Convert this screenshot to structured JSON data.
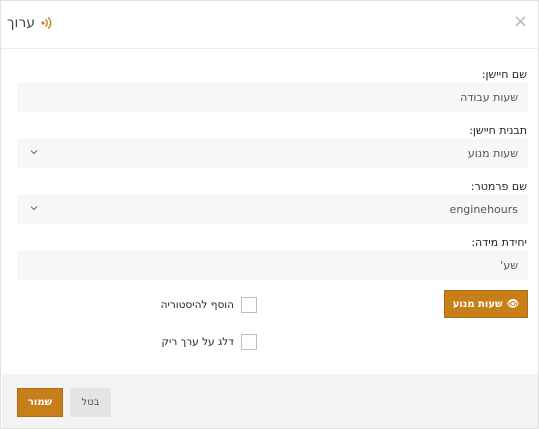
{
  "header": {
    "title": "ערוך",
    "close_glyph": "×",
    "accent": "#c87f1a"
  },
  "form": {
    "sensor_name_label": "שם חיישן:",
    "sensor_name_value": "שעות עבודה",
    "sensor_template_label": "תבנית חיישן:",
    "sensor_template_value": "שעות מנוע",
    "param_name_label": "שם פרמטר:",
    "param_name_value": "enginehours",
    "unit_label": "יחידת מידה:",
    "unit_value": "שע'"
  },
  "engine_hours_button": {
    "label": "שעות מנוע",
    "icon": "eye-icon"
  },
  "checkboxes": {
    "add_history_label": "הוסף להיסטוריה",
    "skip_empty_label": "דלג על ערך ריק"
  },
  "footer": {
    "save_label": "שמור",
    "cancel_label": "בטל"
  }
}
